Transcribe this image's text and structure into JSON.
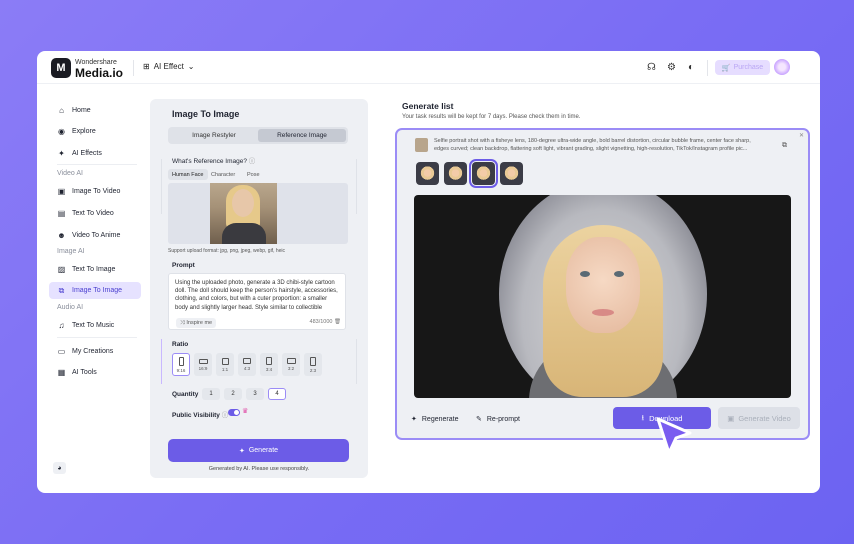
{
  "topbar": {
    "logo_letter": "M",
    "brand_top": "Wondershare",
    "brand_main": "Media.io",
    "effect_label": "AI Effect",
    "purchase_label": "Purchase"
  },
  "sidebar": {
    "items": [
      {
        "label": "Home",
        "icon": "home-icon"
      },
      {
        "label": "Explore",
        "icon": "compass-icon"
      },
      {
        "label": "AI Effects",
        "icon": "sparkle-icon"
      }
    ],
    "video_section": "Video AI",
    "video_items": [
      "Image To Video",
      "Text To Video",
      "Video To Anime"
    ],
    "image_section": "Image AI",
    "image_items": [
      "Text To Image",
      "Image To Image"
    ],
    "audio_section": "Audio AI",
    "audio_items": [
      "Text To Music"
    ],
    "bottom_items": [
      "My Creations",
      "AI Tools"
    ]
  },
  "panel": {
    "title": "Image To Image",
    "tabs": [
      "Image Restyler",
      "Reference Image"
    ],
    "ref_question": "What's Reference Image?",
    "ref_types": [
      "Human Face",
      "Character",
      "Pose"
    ],
    "formats": "Support upload format: jpg, png, jpeg, webp, gif, heic",
    "prompt_label": "Prompt",
    "prompt_text": "Using the uploaded photo, generate a 3D chibi-style cartoon doll. The doll should keep the person's hairstyle, accessories, clothing, and colors, but with a cuter proportion: a smaller body and slightly larger head. Style similar to collectible figures or anime merchandise, with a",
    "inspire": "Inspire me",
    "counter": "483/1000",
    "ratio_label": "Ratio",
    "ratios": [
      "9:16",
      "16:9",
      "1:1",
      "4:3",
      "3:4",
      "3:2",
      "2:3"
    ],
    "quantity_label": "Quantity",
    "quantities": [
      "1",
      "2",
      "3",
      "4"
    ],
    "visibility_label": "Public Visibility",
    "generate": "Generate",
    "note": "Generated by AI. Please use responsibly."
  },
  "results": {
    "title": "Generate list",
    "subtitle": "Your task results will be kept for 7 days. Please check them in time.",
    "prompt": "Selfie portrait shot with a fisheye lens, 180-degree ultra-wide angle, bold barrel distortion, circular bubble frame, center face sharp, edges curved; clean backdrop, flattering soft light, vibrant grading, slight vignetting, high-resolution, TikTok/Instagram profile pic...",
    "regenerate": "Regenerate",
    "reprompt": "Re-prompt",
    "download": "Download",
    "generate_video": "Generate Video"
  }
}
